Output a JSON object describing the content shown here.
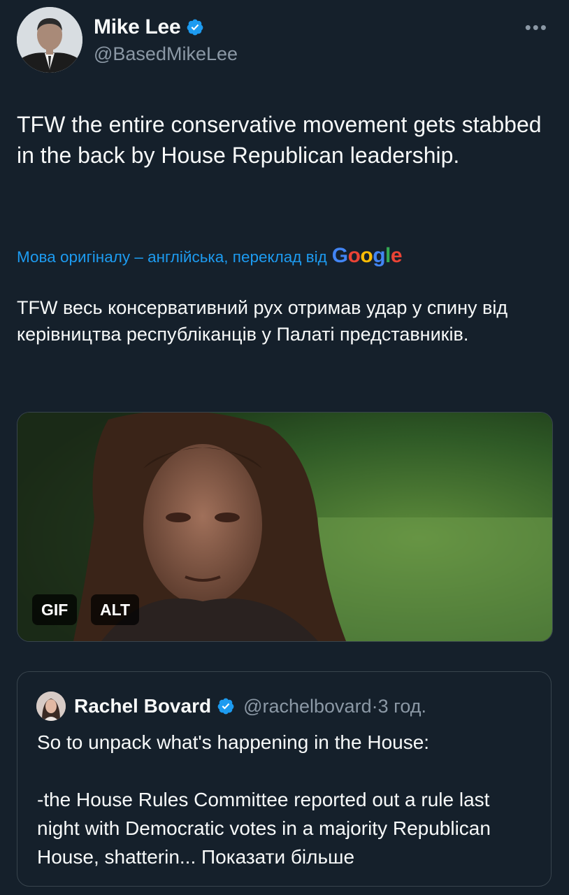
{
  "author": {
    "name": "Mike Lee",
    "handle": "@BasedMikeLee",
    "avatar_icon": "profile-photo",
    "verified_icon": "verified-badge-icon",
    "more_label": "•••"
  },
  "tweet": {
    "text": "TFW the entire conservative movement gets stabbed in the back by House Republican leadership.",
    "translation_note": "Мова оригіналу – англійська, переклад від",
    "translation_provider": [
      "G",
      "o",
      "o",
      "g",
      "l",
      "e"
    ],
    "translated_text": "TFW весь консервативний рух отримав удар у спину від керівництва республіканців у Палаті представників."
  },
  "media": {
    "gif_label": "GIF",
    "alt_label": "ALT"
  },
  "quoted": {
    "name": "Rachel Bovard",
    "handle": "@rachelbovard",
    "separator": "·",
    "time": "3 год.",
    "text_line1": "So to unpack what's happening in the House:",
    "text_body": "-the House Rules Committee reported out a rule last night with Democratic votes in a majority Republican House, shatterin...",
    "show_more": "Показати більше"
  },
  "colors": {
    "background": "#15202b",
    "accent": "#1d9bf0",
    "secondary_text": "#8b98a5",
    "border": "#38444d"
  }
}
